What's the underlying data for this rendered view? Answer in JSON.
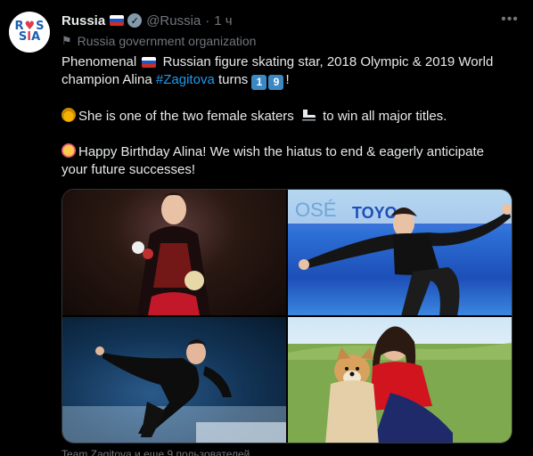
{
  "account": {
    "name": "Russia",
    "handle": "@Russia",
    "separator": "·",
    "time": "1 ч",
    "affiliation": "Russia government organization",
    "avatar_text_top": "R♥S",
    "avatar_text_bottom": "SIA"
  },
  "tweet": {
    "p1_a": "Phenomenal",
    "p1_b": "Russian figure skating star, 2018 Olympic & 2019 World champion Alina",
    "hashtag": "#Zagitova",
    "p1_c": "turns",
    "age_digit_1": "1",
    "age_digit_2": "9",
    "p1_end": "!",
    "p2_a": "She is one of the two female skaters",
    "p2_b": "to win all major titles.",
    "p3": "Happy Birthday Alina! We wish the hiatus to end & eagerly anticipate your future successes!"
  },
  "media": {
    "banner_text_1": "OSÉ",
    "banner_text_2": "TOYO"
  },
  "footer": {
    "tagged": "Team Zagitova и еще 9 пользователей"
  },
  "icons": {
    "verified": "verified-badge-icon",
    "more": "more-icon",
    "pennant": "flag-pennant-icon"
  },
  "colors": {
    "background": "#000000",
    "text": "#e7e9ea",
    "muted": "#71767b",
    "link": "#1d9bf0"
  }
}
